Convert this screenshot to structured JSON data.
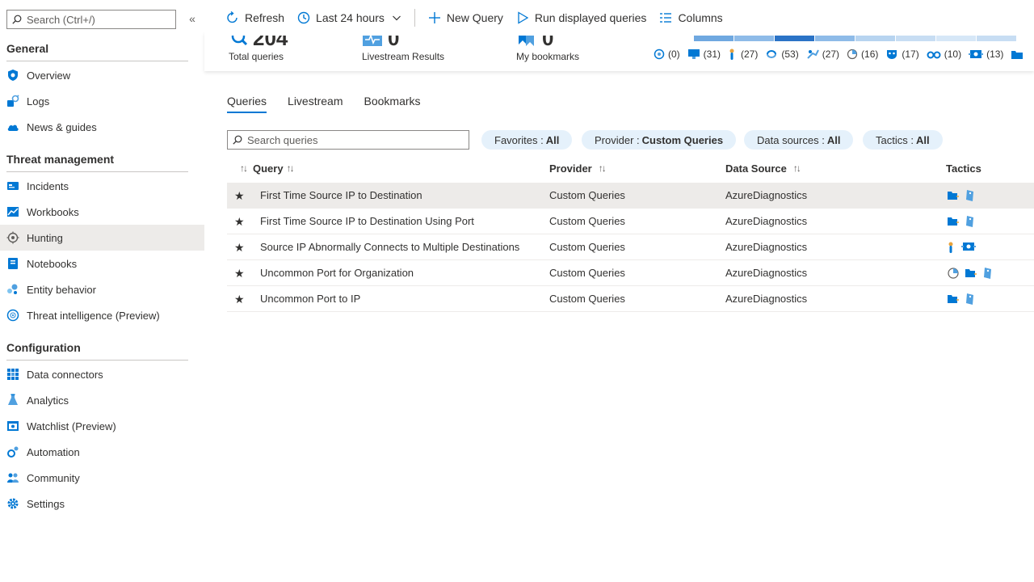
{
  "sidebar": {
    "search_placeholder": "Search (Ctrl+/)",
    "collapse_glyph": "«",
    "sections": [
      {
        "title": "General",
        "items": [
          {
            "label": "Overview",
            "icon": "shield-icon"
          },
          {
            "label": "Logs",
            "icon": "logs-icon"
          },
          {
            "label": "News & guides",
            "icon": "cloud-icon"
          }
        ]
      },
      {
        "title": "Threat management",
        "items": [
          {
            "label": "Incidents",
            "icon": "incidents-icon"
          },
          {
            "label": "Workbooks",
            "icon": "workbooks-icon"
          },
          {
            "label": "Hunting",
            "icon": "target-icon"
          },
          {
            "label": "Notebooks",
            "icon": "notebook-icon"
          },
          {
            "label": "Entity behavior",
            "icon": "entity-icon"
          },
          {
            "label": "Threat intelligence (Preview)",
            "icon": "globe-icon"
          }
        ]
      },
      {
        "title": "Configuration",
        "items": [
          {
            "label": "Data connectors",
            "icon": "grid-icon"
          },
          {
            "label": "Analytics",
            "icon": "flask-icon"
          },
          {
            "label": "Watchlist (Preview)",
            "icon": "watchlist-icon"
          },
          {
            "label": "Automation",
            "icon": "gear-flow-icon"
          },
          {
            "label": "Community",
            "icon": "community-icon"
          },
          {
            "label": "Settings",
            "icon": "gear-icon"
          }
        ]
      }
    ],
    "active_item": "Hunting"
  },
  "toolbar": {
    "refresh": "Refresh",
    "timerange": "Last 24 hours",
    "new_query": "New Query",
    "run": "Run displayed queries",
    "columns": "Columns"
  },
  "stats": {
    "total_queries": {
      "value": "204",
      "label": "Total queries"
    },
    "livestream": {
      "value": "0",
      "label": "Livestream Results"
    },
    "bookmarks": {
      "value": "0",
      "label": "My bookmarks"
    },
    "tactic_counts": [
      "(0)",
      "(31)",
      "(27)",
      "(53)",
      "(27)",
      "(16)",
      "(17)",
      "(10)",
      "(13)"
    ],
    "segment_colors": [
      "#6fa8e0",
      "#8ebbe8",
      "#2b73c6",
      "#8ebbe8",
      "#b7d4f0",
      "#c7ddf3",
      "#d6e7f7",
      "#c7ddf3"
    ]
  },
  "tabs": [
    "Queries",
    "Livestream",
    "Bookmarks"
  ],
  "filters": {
    "search_placeholder": "Search queries",
    "favorites": {
      "label": "Favorites :",
      "value": "All"
    },
    "provider": {
      "label": "Provider :",
      "value": "Custom Queries"
    },
    "datasources": {
      "label": "Data sources :",
      "value": "All"
    },
    "tactics": {
      "label": "Tactics :",
      "value": "All"
    }
  },
  "table": {
    "headers": {
      "query": "Query",
      "provider": "Provider",
      "datasource": "Data Source",
      "tactics": "Tactics"
    },
    "rows": [
      {
        "query": "First Time Source IP to Destination",
        "provider": "Custom Queries",
        "datasource": "AzureDiagnostics",
        "tactics": [
          "folder-arrow-icon",
          "bookmark-tag-icon"
        ]
      },
      {
        "query": "First Time Source IP to Destination Using Port",
        "provider": "Custom Queries",
        "datasource": "AzureDiagnostics",
        "tactics": [
          "folder-arrow-icon",
          "bookmark-tag-icon"
        ]
      },
      {
        "query": "Source IP Abnormally Connects to Multiple Destinations",
        "provider": "Custom Queries",
        "datasource": "AzureDiagnostics",
        "tactics": [
          "pointer-icon",
          "network-icon"
        ]
      },
      {
        "query": "Uncommon Port for Organization",
        "provider": "Custom Queries",
        "datasource": "AzureDiagnostics",
        "tactics": [
          "radar-icon",
          "folder-arrow-icon",
          "bookmark-tag-icon"
        ]
      },
      {
        "query": "Uncommon Port to IP",
        "provider": "Custom Queries",
        "datasource": "AzureDiagnostics",
        "tactics": [
          "folder-arrow-icon",
          "bookmark-tag-icon"
        ]
      }
    ]
  }
}
